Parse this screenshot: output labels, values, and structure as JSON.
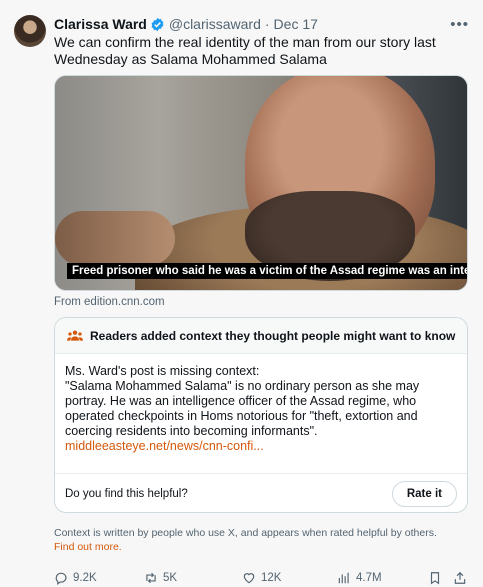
{
  "author": {
    "name": "Clarissa Ward",
    "handle": "@clarissaward",
    "separator": "·",
    "date": "Dec 17"
  },
  "tweet": {
    "text": "We can confirm the real identity of the man from our story last Wednesday as Salama Mohammed Salama"
  },
  "media": {
    "caption": "Freed prisoner who said he was a victim of the Assad regime was an intelligen...",
    "source": "From edition.cnn.com"
  },
  "note": {
    "title": "Readers added context they thought people might want to know",
    "lines": [
      "Ms. Ward's post is missing context:",
      "\"Salama Mohammed Salama\" is no ordinary person as she may portray. He was an intelligence officer of the Assad regime, who operated checkpoints in Homs notorious for \"theft, extortion and coercing residents into becoming informants\"."
    ],
    "link": "middleeasteye.net/news/cnn-confi...",
    "question": "Do you find this helpful?",
    "rate_label": "Rate it"
  },
  "disclaimer": {
    "text": "Context is written by people who use X, and appears when rated helpful by others.",
    "link": "Find out more."
  },
  "actions": {
    "replies": "9.2K",
    "reposts": "5K",
    "likes": "12K",
    "views": "4.7M"
  },
  "colors": {
    "accent_link": "#d6590b",
    "verified": "#1d9bf0",
    "muted": "#536471"
  }
}
